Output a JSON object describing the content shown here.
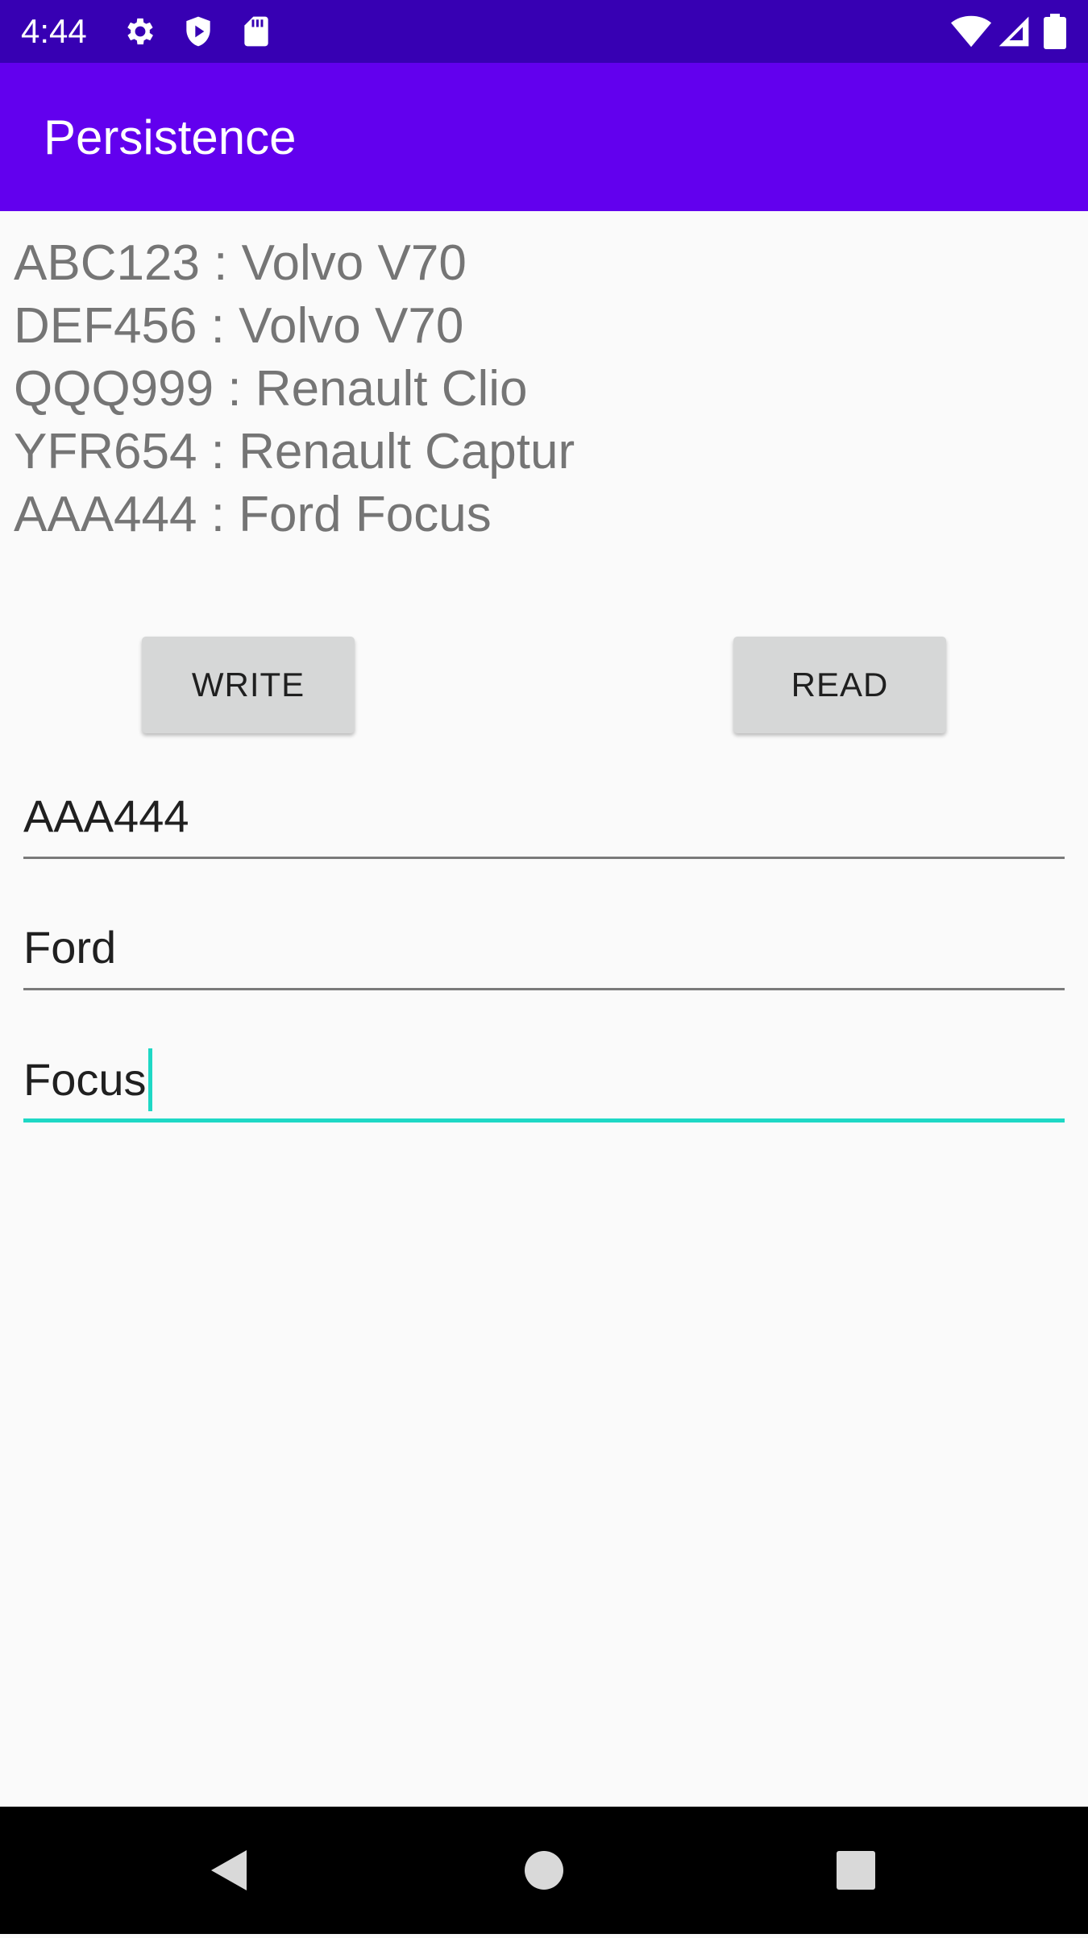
{
  "status_bar": {
    "time": "4:44",
    "icons_left": [
      "settings-icon",
      "shield-icon",
      "sd-card-icon"
    ],
    "icons_right": [
      "wifi-icon",
      "signal-icon",
      "battery-icon"
    ],
    "background": "#3700b3"
  },
  "app_bar": {
    "title": "Persistence",
    "background": "#6200ee"
  },
  "car_list": [
    "ABC123 : Volvo V70",
    "DEF456 : Volvo V70",
    "QQQ999 : Renault Clio",
    "YFR654 : Renault Captur",
    "AAA444 : Ford Focus"
  ],
  "buttons": {
    "write_label": "WRITE",
    "read_label": "READ"
  },
  "fields": {
    "plate_value": "AAA444",
    "make_value": "Ford",
    "model_value": "Focus"
  },
  "colors": {
    "accent": "#1ed8c5",
    "list_text": "#757575",
    "button_bg": "#d6d7d7"
  },
  "nav_bar": {
    "icons": [
      "back-icon",
      "home-icon",
      "recents-icon"
    ]
  }
}
